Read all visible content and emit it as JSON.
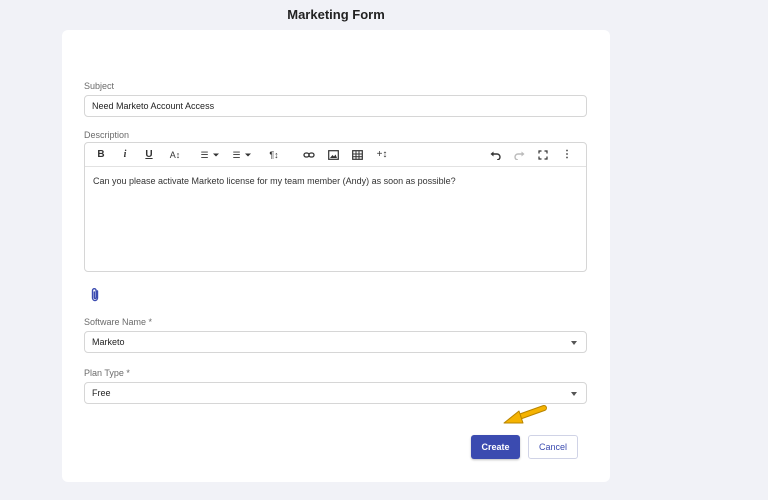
{
  "page": {
    "title": "Marketing Form"
  },
  "form": {
    "subject": {
      "label": "Subject",
      "value": "Need Marketo Account Access"
    },
    "description": {
      "label": "Description",
      "value": "Can you please activate Marketo license for my team member (Andy) as soon as possible?",
      "toolbar": {
        "bold": "B",
        "italic": "i",
        "underline": "U",
        "font_size": "A↕",
        "ordered_list": "☰",
        "bullet_list": "☰",
        "paragraph": "¶↕",
        "insert_more": "+↕",
        "more": "⋮"
      }
    },
    "software_name": {
      "label": "Software Name *",
      "value": "Marketo"
    },
    "plan_type": {
      "label": "Plan Type *",
      "value": "Free"
    }
  },
  "actions": {
    "create_label": "Create",
    "cancel_label": "Cancel"
  },
  "colors": {
    "primary": "#3b4bb0",
    "background": "#f1f2f7",
    "arrow": "#f5b301"
  }
}
